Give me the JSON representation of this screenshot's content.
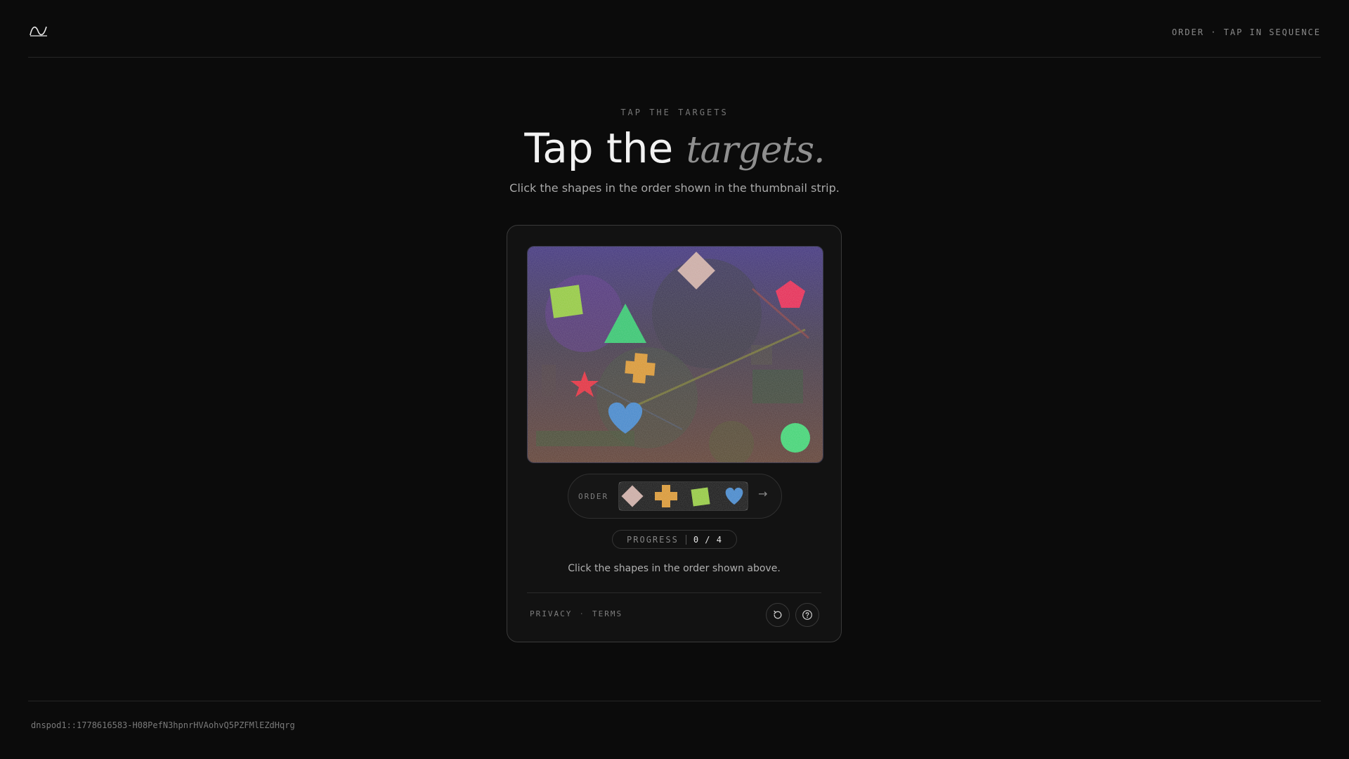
{
  "header": {
    "logo_icon": "waveform-logo-icon",
    "mode_label": "ORDER · TAP IN SEQUENCE"
  },
  "hero": {
    "kicker": "TAP THE TARGETS",
    "title_main": "Tap the ",
    "title_emphasis": "targets.",
    "subtitle": "Click the shapes in the order shown in the thumbnail strip."
  },
  "challenge": {
    "shapes": [
      {
        "kind": "square",
        "color": "#8fc63a"
      },
      {
        "kind": "diamond",
        "color": "#c8a7a0"
      },
      {
        "kind": "pentagon",
        "color": "#e3244e"
      },
      {
        "kind": "triangle",
        "color": "#2fc26a"
      },
      {
        "kind": "cross",
        "color": "#d6922c"
      },
      {
        "kind": "star",
        "color": "#e02838"
      },
      {
        "kind": "heart",
        "color": "#3e82c8"
      },
      {
        "kind": "circle",
        "color": "#3bd16f"
      }
    ],
    "order_label": "ORDER",
    "order_sequence": [
      {
        "kind": "diamond",
        "color": "#c8a7a0"
      },
      {
        "kind": "cross",
        "color": "#d6922c"
      },
      {
        "kind": "square",
        "color": "#8fc63a"
      },
      {
        "kind": "heart",
        "color": "#3e82c8"
      }
    ],
    "next_icon": "arrow-right-icon",
    "progress_label": "PROGRESS",
    "progress_value": "0 / 4",
    "progress_done": 0,
    "progress_total": 4,
    "instruction": "Click the shapes in the order shown above."
  },
  "footer_links": {
    "privacy": "PRIVACY",
    "separator": "·",
    "terms": "TERMS"
  },
  "controls": {
    "refresh_icon": "refresh-icon",
    "help_icon": "help-icon"
  },
  "session_id": "dnspod1::1778616583-H08PefN3hpnrHVAohvQ5PZFMlEZdHqrg"
}
